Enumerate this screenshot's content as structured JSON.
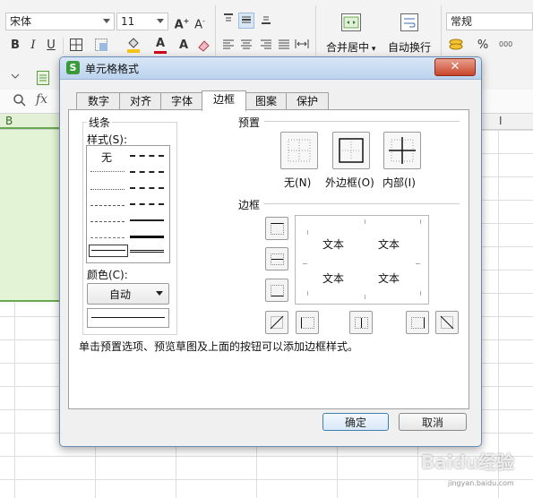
{
  "ribbon": {
    "font_name": "宋体",
    "font_size": "11",
    "bold": "B",
    "italic": "I",
    "underline": "U",
    "merge_center_label": "合并居中",
    "wrap_text_label": "自动换行",
    "number_format": "常规",
    "percent": "%"
  },
  "formula_bar": {
    "fx": "fx"
  },
  "columns": {
    "b": "B",
    "i": "I"
  },
  "dialog": {
    "title": "单元格格式",
    "close_glyph": "✕",
    "tabs": [
      {
        "label": "数字"
      },
      {
        "label": "对齐"
      },
      {
        "label": "字体"
      },
      {
        "label": "边框"
      },
      {
        "label": "图案"
      },
      {
        "label": "保护"
      }
    ],
    "active_tab": "边框",
    "line_group": {
      "title": "线条",
      "style_label": "样式(S):",
      "none_label": "无",
      "color_label": "颜色(C):",
      "color_value": "自动"
    },
    "preset_group": {
      "title": "预置",
      "buttons": [
        {
          "label": "无(N)",
          "icon": "border-none-icon"
        },
        {
          "label": "外边框(O)",
          "icon": "border-outline-icon"
        },
        {
          "label": "内部(I)",
          "icon": "border-inside-icon"
        }
      ]
    },
    "border_group": {
      "title": "边框",
      "preview_text": [
        "文本",
        "文本",
        "文本",
        "文本"
      ]
    },
    "hint": "单击预置选项、预览草图及上面的按钮可以添加边框样式。",
    "ok_label": "确定",
    "cancel_label": "取消"
  },
  "watermark": {
    "text": "Baidu经验",
    "sub": "jingyan.baidu.com"
  },
  "colors": {
    "accent_green": "#6aa84f",
    "selection_fill": "#e3f3d6",
    "title_gradient": "#bcd3ee",
    "close_red": "#c9452c"
  }
}
